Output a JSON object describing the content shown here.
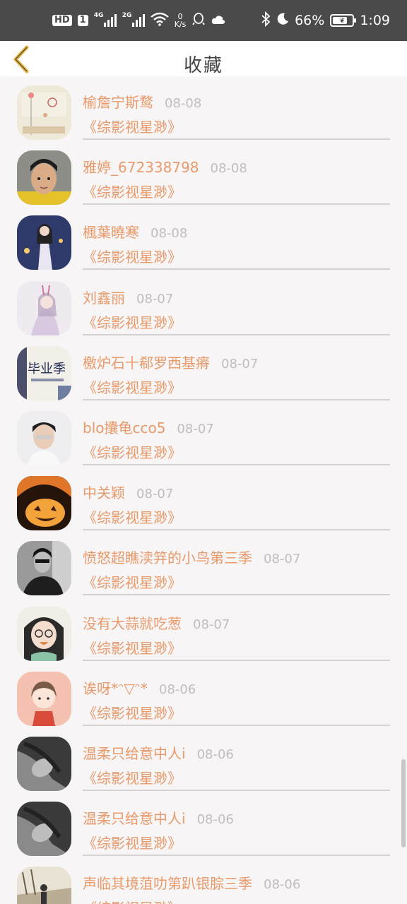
{
  "status_bar": {
    "badge_hd": "HD",
    "badge_sim": "1",
    "net1": "4G",
    "net2": "2G",
    "speed_value": "0",
    "speed_unit": "K/s",
    "battery": "66%",
    "time": "1:09"
  },
  "header": {
    "title": "收藏"
  },
  "items": [
    {
      "name": "榆詹宁斯鹜",
      "date": "08-08",
      "work": "《综影视星渺》",
      "avatar": "avatar-1"
    },
    {
      "name": "雅婷_672338798",
      "date": "08-08",
      "work": "《综影视星渺》",
      "avatar": "avatar-2"
    },
    {
      "name": "楓葉曉寒",
      "date": "08-08",
      "work": "《综影视星渺》",
      "avatar": "avatar-3"
    },
    {
      "name": "刘鑫丽",
      "date": "08-07",
      "work": "《综影视星渺》",
      "avatar": "avatar-4"
    },
    {
      "name": "檄炉石十郗罗西基瘠",
      "date": "08-07",
      "work": "《综影视星渺》",
      "avatar": "avatar-5"
    },
    {
      "name": "blo攮龟cco5",
      "date": "08-07",
      "work": "《综影视星渺》",
      "avatar": "avatar-6"
    },
    {
      "name": "中关颖",
      "date": "08-07",
      "work": "《综影视星渺》",
      "avatar": "avatar-7"
    },
    {
      "name": "愤怒超瞧渎笄的小鸟第三季",
      "date": "08-07",
      "work": "《综影视星渺》",
      "avatar": "avatar-8"
    },
    {
      "name": "没有大蒜就吃葱",
      "date": "08-07",
      "work": "《综影视星渺》",
      "avatar": "avatar-9"
    },
    {
      "name": "诶呀*ᵔ▽ᵔ*",
      "date": "08-06",
      "work": "《综影视星渺》",
      "avatar": "avatar-10"
    },
    {
      "name": "温柔只给意中人i",
      "date": "08-06",
      "work": "《综影视星渺》",
      "avatar": "avatar-11"
    },
    {
      "name": "温柔只给意中人i",
      "date": "08-06",
      "work": "《综影视星渺》",
      "avatar": "avatar-12"
    },
    {
      "name": "声临其境菹叻第趴银腙三季",
      "date": "08-06",
      "work": "《综影视星渺》",
      "avatar": "avatar-13"
    }
  ],
  "avatar_5_text": "毕业季",
  "colors": {
    "accent": "#e89a6a",
    "date": "#c2bdbd",
    "back_arrow": "#e5b43a",
    "status_bar_bg": "#4a4a4a",
    "list_bg": "#f7f5f6"
  }
}
